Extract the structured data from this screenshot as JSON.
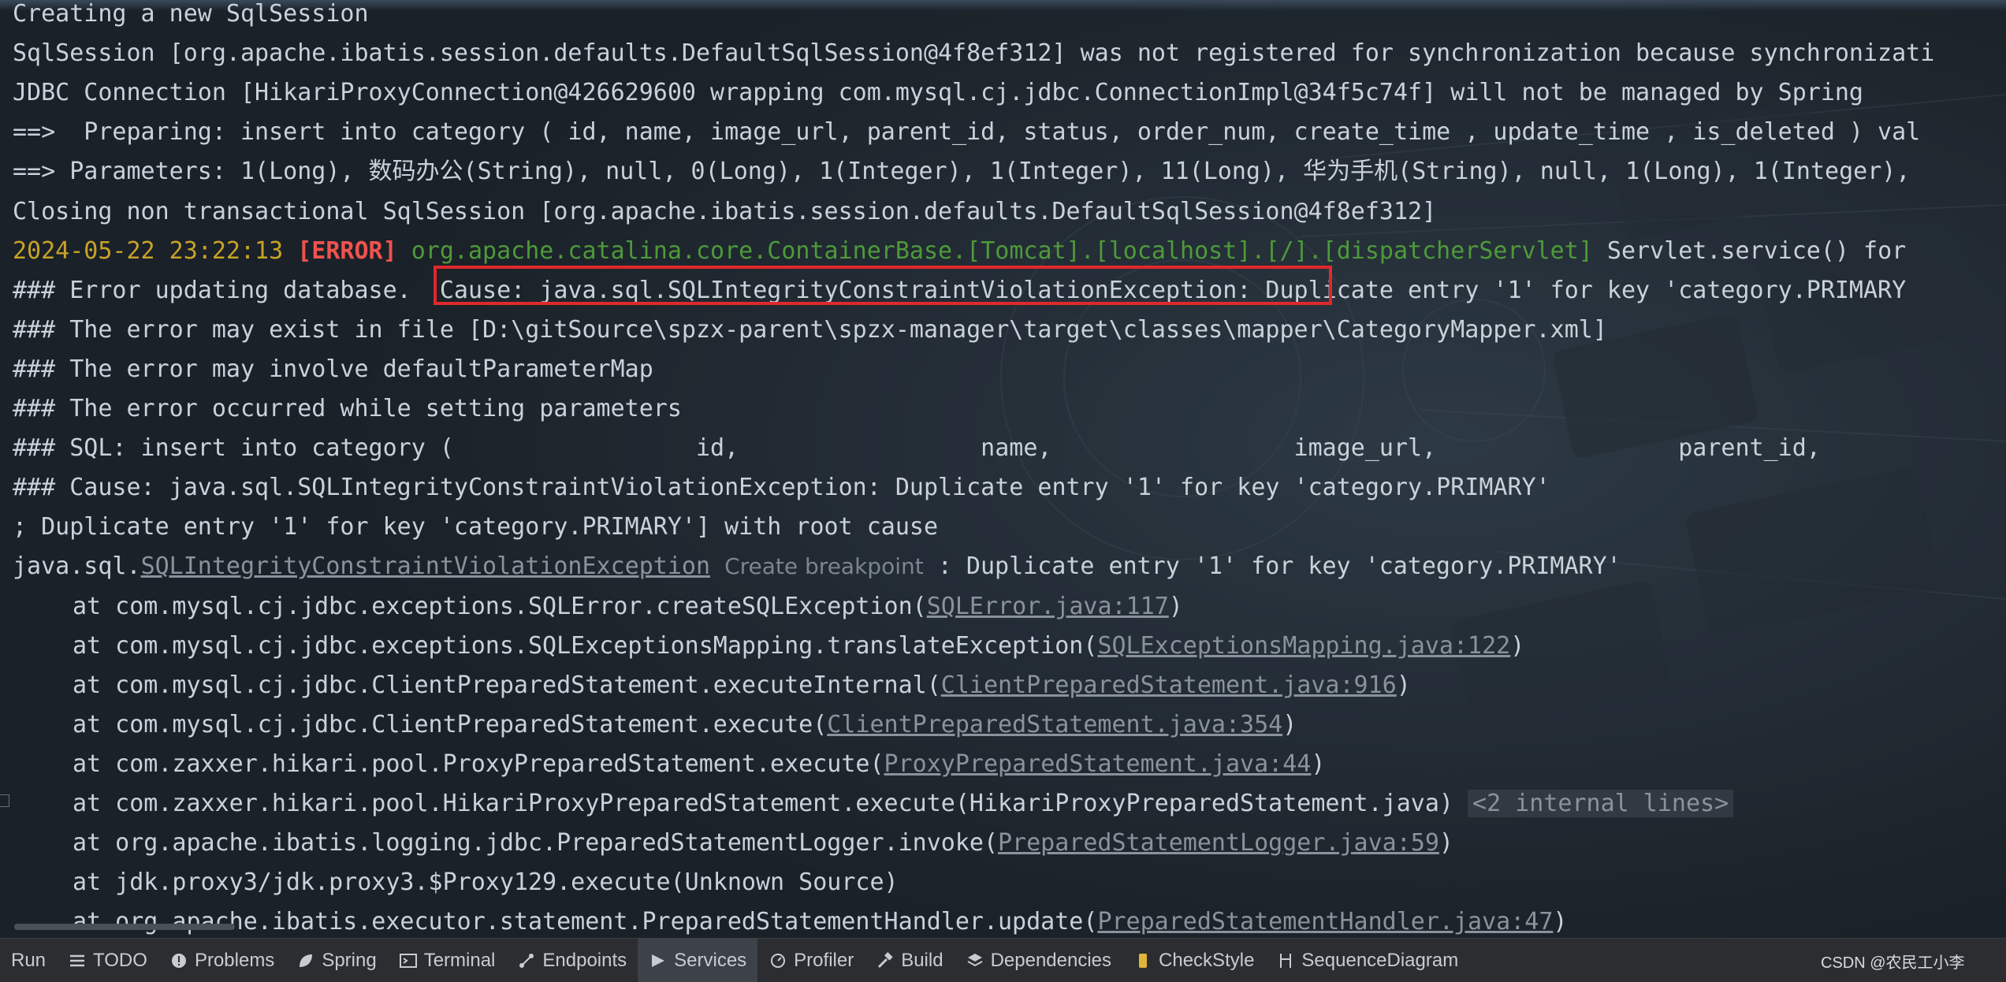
{
  "console": {
    "lines": [
      {
        "id": "l0",
        "segments": [
          {
            "t": "Creating a new SqlSession"
          }
        ]
      },
      {
        "id": "l1",
        "segments": [
          {
            "t": "SqlSession [org.apache.ibatis.session.defaults.DefaultSqlSession@4f8ef312] was not registered for synchronization because synchronizati"
          }
        ]
      },
      {
        "id": "l2",
        "segments": [
          {
            "t": "JDBC Connection [HikariProxyConnection@426629600 wrapping com.mysql.cj.jdbc.ConnectionImpl@34f5c74f] will not be managed by Spring"
          }
        ]
      },
      {
        "id": "l3",
        "segments": [
          {
            "t": "==>  Preparing: insert into category ( id, name, image_url, parent_id, status, order_num, create_time , update_time , is_deleted ) val"
          }
        ]
      },
      {
        "id": "l4",
        "segments": [
          {
            "t": "==> Parameters: 1(Long), 数码办公(String), null, 0(Long), 1(Integer), 1(Integer), 11(Long), 华为手机(String), null, 1(Long), 1(Integer),"
          }
        ]
      },
      {
        "id": "l5",
        "segments": [
          {
            "t": "Closing non transactional SqlSession [org.apache.ibatis.session.defaults.DefaultSqlSession@4f8ef312]"
          }
        ]
      },
      {
        "id": "l6",
        "segments": [
          {
            "t": "2024-05-22 23:22:13 ",
            "c": "date"
          },
          {
            "t": "[ERROR]",
            "c": "err"
          },
          {
            "t": " "
          },
          {
            "t": "org.apache.catalina.core.ContainerBase.[Tomcat].[localhost].[/].[dispatcherServlet]",
            "c": "green"
          },
          {
            "t": " Servlet.service() for"
          }
        ]
      },
      {
        "id": "l7",
        "segments": [
          {
            "t": "### Error updating database.  Cause: java.sql.SQLIntegrityConstraintViolationException: Duplicate entry '1' for key 'category.PRIMARY"
          }
        ]
      },
      {
        "id": "l8",
        "segments": [
          {
            "t": "### The error may exist in file [D:\\gitSource\\spzx-parent\\spzx-manager\\target\\classes\\mapper\\CategoryMapper.xml]"
          }
        ]
      },
      {
        "id": "l9",
        "segments": [
          {
            "t": "### The error may involve defaultParameterMap"
          }
        ]
      },
      {
        "id": "l10",
        "segments": [
          {
            "t": "### The error occurred while setting parameters"
          }
        ]
      },
      {
        "id": "l11",
        "segments": [
          {
            "t": "### SQL: insert into category (                 id,                 name,                 image_url,                 parent_id,"
          }
        ]
      },
      {
        "id": "l12",
        "segments": [
          {
            "t": "### Cause: java.sql.SQLIntegrityConstraintViolationException: Duplicate entry '1' for key 'category.PRIMARY'"
          }
        ]
      },
      {
        "id": "l13",
        "segments": [
          {
            "t": "; Duplicate entry '1' for key 'category.PRIMARY'] with root cause"
          }
        ]
      },
      {
        "id": "l14",
        "segments": [
          {
            "t": "java.sql."
          },
          {
            "t": "SQLIntegrityConstraintViolationException",
            "c": "link"
          },
          {
            "t": " "
          },
          {
            "t": "Create breakpoint",
            "c": "hint"
          },
          {
            "t": " : Duplicate entry '1' for key 'category.PRIMARY'"
          }
        ]
      },
      {
        "id": "l15",
        "indent": true,
        "segments": [
          {
            "t": "at com.mysql.cj.jdbc.exceptions.SQLError.createSQLException("
          },
          {
            "t": "SQLError.java:117",
            "c": "link"
          },
          {
            "t": ")"
          }
        ]
      },
      {
        "id": "l16",
        "indent": true,
        "segments": [
          {
            "t": "at com.mysql.cj.jdbc.exceptions.SQLExceptionsMapping.translateException("
          },
          {
            "t": "SQLExceptionsMapping.java:122",
            "c": "link"
          },
          {
            "t": ")"
          }
        ]
      },
      {
        "id": "l17",
        "indent": true,
        "segments": [
          {
            "t": "at com.mysql.cj.jdbc.ClientPreparedStatement.executeInternal("
          },
          {
            "t": "ClientPreparedStatement.java:916",
            "c": "link"
          },
          {
            "t": ")"
          }
        ]
      },
      {
        "id": "l18",
        "indent": true,
        "segments": [
          {
            "t": "at com.mysql.cj.jdbc.ClientPreparedStatement.execute("
          },
          {
            "t": "ClientPreparedStatement.java:354",
            "c": "link"
          },
          {
            "t": ")"
          }
        ]
      },
      {
        "id": "l19",
        "indent": true,
        "segments": [
          {
            "t": "at com.zaxxer.hikari.pool.ProxyPreparedStatement.execute("
          },
          {
            "t": "ProxyPreparedStatement.java:44",
            "c": "link"
          },
          {
            "t": ")"
          }
        ]
      },
      {
        "id": "l20",
        "indent": true,
        "segments": [
          {
            "t": "at com.zaxxer.hikari.pool.HikariProxyPreparedStatement.execute(HikariProxyPreparedStatement.java) "
          },
          {
            "t": "<2 internal lines>",
            "c": "fold"
          }
        ]
      },
      {
        "id": "l21",
        "indent": true,
        "segments": [
          {
            "t": "at org.apache.ibatis.logging.jdbc.PreparedStatementLogger.invoke("
          },
          {
            "t": "PreparedStatementLogger.java:59",
            "c": "link"
          },
          {
            "t": ")"
          }
        ]
      },
      {
        "id": "l22",
        "indent": true,
        "segments": [
          {
            "t": "at jdk.proxy3/jdk.proxy3.$Proxy129.execute(Unknown Source)"
          }
        ]
      },
      {
        "id": "l23",
        "indent": true,
        "segments": [
          {
            "t": "at org.apache.ibatis.executor.statement.PreparedStatementHandler.update("
          },
          {
            "t": "PreparedStatementHandler.java:47",
            "c": "link"
          },
          {
            "t": ")"
          }
        ]
      }
    ]
  },
  "toolbar": {
    "items": [
      {
        "label": "Run",
        "icon": "run-icon"
      },
      {
        "label": "TODO",
        "icon": "list-icon"
      },
      {
        "label": "Problems",
        "icon": "problems-icon"
      },
      {
        "label": "Spring",
        "icon": "spring-leaf-icon"
      },
      {
        "label": "Terminal",
        "icon": "terminal-icon"
      },
      {
        "label": "Endpoints",
        "icon": "endpoints-icon"
      },
      {
        "label": "Services",
        "icon": "services-icon",
        "active": true
      },
      {
        "label": "Profiler",
        "icon": "profiler-icon"
      },
      {
        "label": "Build",
        "icon": "hammer-icon"
      },
      {
        "label": "Dependencies",
        "icon": "layers-icon"
      },
      {
        "label": "CheckStyle",
        "icon": "checkstyle-icon"
      },
      {
        "label": "SequenceDiagram",
        "icon": "sequence-diagram-icon"
      }
    ]
  },
  "watermark": "CSDN @农民工小李"
}
